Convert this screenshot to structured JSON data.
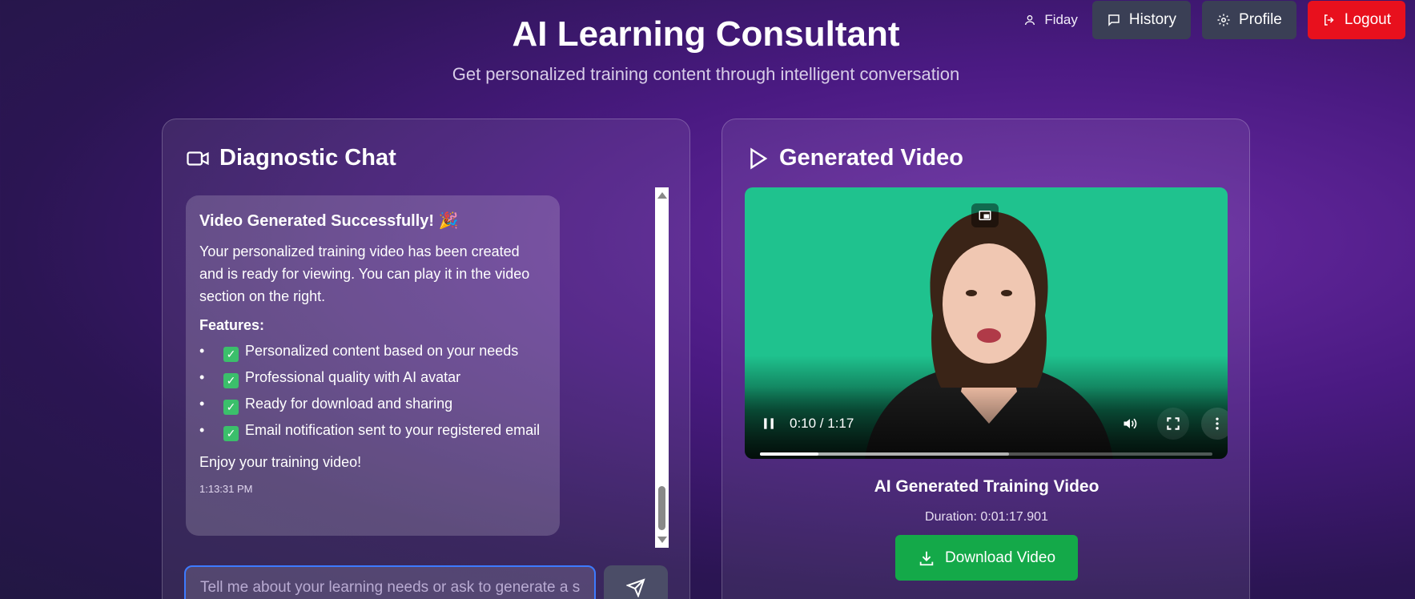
{
  "header": {
    "title": "AI Learning Consultant",
    "subtitle": "Get personalized training content through intelligent conversation"
  },
  "nav": {
    "username": "Fiday",
    "history_label": "History",
    "profile_label": "Profile",
    "logout_label": "Logout",
    "logout_color": "#e8101d"
  },
  "chat": {
    "heading": "Diagnostic Chat",
    "message": {
      "title": "Video Generated Successfully! 🎉",
      "body": "Your personalized training video has been created and is ready for viewing. You can play it in the video section on the right.",
      "features_label": "Features:",
      "features": [
        "Personalized content based on your needs",
        "Professional quality with AI avatar",
        "Ready for download and sharing",
        "Email notification sent to your registered email"
      ],
      "closing": "Enjoy your training video!",
      "timestamp": "1:13:31 PM"
    },
    "input_placeholder": "Tell me about your learning needs or ask to generate a se",
    "input_value": ""
  },
  "video": {
    "heading": "Generated Video",
    "time_display": "0:10 / 1:17",
    "progress_played": 0.13,
    "progress_buffered": 0.55,
    "title": "AI Generated Training Video",
    "duration": "Duration: 0:01:17.901",
    "download_label": "Download Video",
    "background_color": "#1fc28e",
    "download_color": "#14a949"
  },
  "icons": {
    "user": "user-icon",
    "history": "chat-bubble-icon",
    "profile": "gear-icon",
    "logout": "logout-icon",
    "chat_heading": "video-camera-icon",
    "video_heading": "play-icon",
    "send": "send-icon",
    "download": "download-icon"
  }
}
